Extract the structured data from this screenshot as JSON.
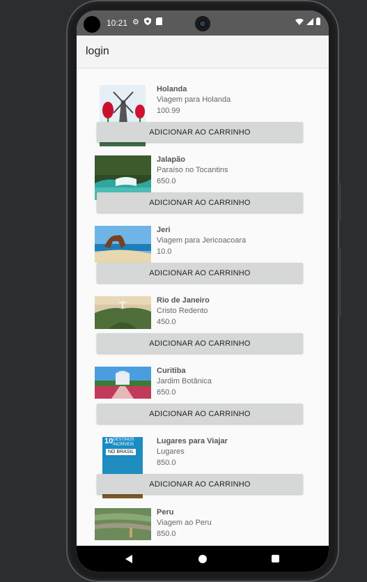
{
  "status": {
    "time": "10:21"
  },
  "appbar": {
    "title": "login"
  },
  "button_label": "ADICIONAR AO CARRINHO",
  "items": [
    {
      "name": "Holanda",
      "subtitle": "Viagem para Holanda",
      "price": "100.99"
    },
    {
      "name": "Jalapão",
      "subtitle": "Paraíso no Tocantins",
      "price": "650.0"
    },
    {
      "name": "Jeri",
      "subtitle": "Viagem para Jericoacoara",
      "price": "10.0"
    },
    {
      "name": "Rio de Janeiro",
      "subtitle": "Cristo Redento",
      "price": "450.0"
    },
    {
      "name": "Curitiba",
      "subtitle": "Jardim Botânica",
      "price": "650.0"
    },
    {
      "name": "Lugares para Viajar",
      "subtitle": "Lugares",
      "price": "850.0",
      "image_text_top": "10",
      "image_text_mid": "DESTINOS INCRÍVEIS",
      "image_text_bottom": "NO BRASIL"
    },
    {
      "name": "Peru",
      "subtitle": "Viagem ao Peru",
      "price": "850.0"
    }
  ]
}
